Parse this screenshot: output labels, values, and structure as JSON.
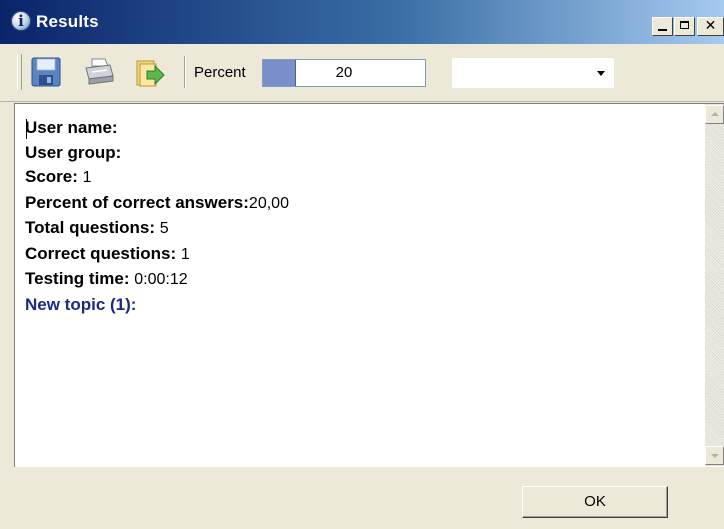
{
  "window": {
    "title": "Results",
    "title_icon": "info-icon",
    "controls": [
      "minimize",
      "maximize",
      "close"
    ]
  },
  "toolbar": {
    "tools": [
      {
        "name": "save",
        "icon": "floppy-disk-icon"
      },
      {
        "name": "print",
        "icon": "printer-icon"
      },
      {
        "name": "export",
        "icon": "export-icon"
      }
    ],
    "percent_label": "Percent",
    "progress_value": "20",
    "progress_percent": 20,
    "combo_value": ""
  },
  "results": {
    "user_name_label": "User name:",
    "user_group_label": "User group:",
    "score_label": "Score:",
    "score_value": "1",
    "percent_label": "Percent of correct answers:",
    "percent_value": "20,00",
    "total_label": "Total questions:",
    "total_value": "5",
    "correct_label": "Correct questions:",
    "correct_value": "1",
    "time_label": "Testing time:",
    "time_value": "0:00:12",
    "topic": "New topic (1):"
  },
  "footer": {
    "ok_label": "OK"
  },
  "colors": {
    "titlebar_start": "#0a246a",
    "titlebar_end": "#a6caf0",
    "progress_fill": "#7a8fca",
    "topic_text": "#1c2a80",
    "window_face": "#ece9d8"
  }
}
